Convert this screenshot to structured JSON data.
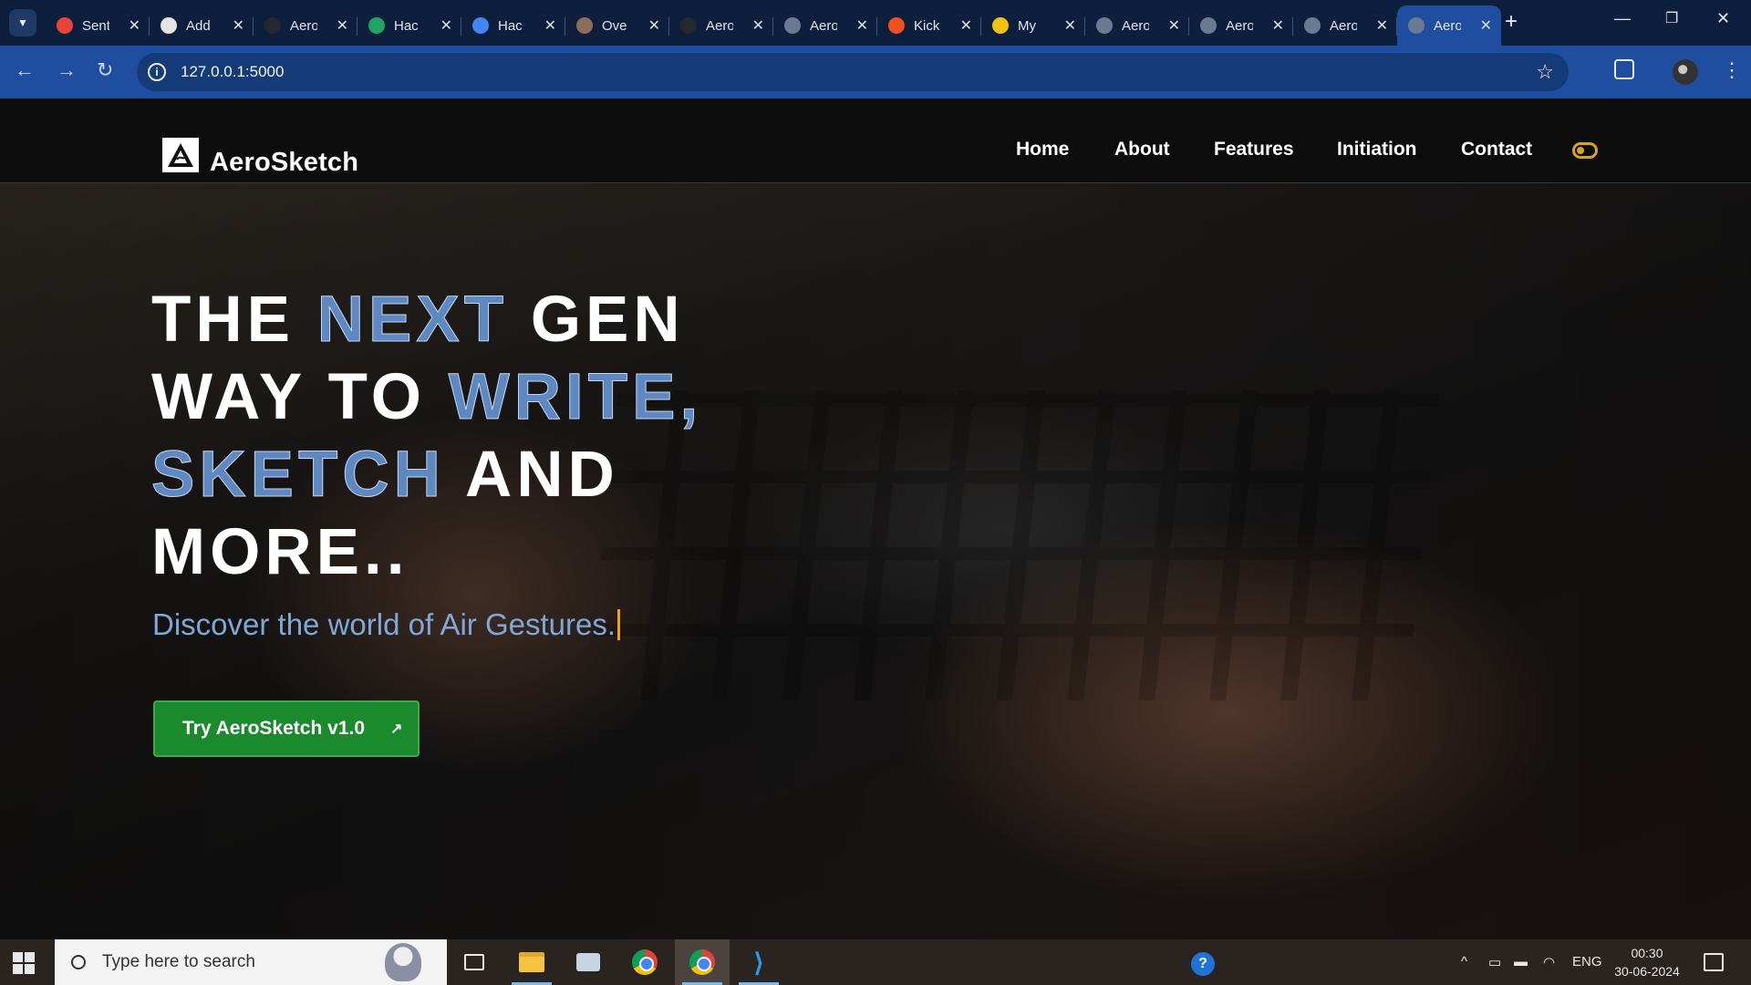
{
  "browser": {
    "tabs": [
      {
        "title": "Sent",
        "icon": "gmail-icon",
        "color": "#ea4335"
      },
      {
        "title": "Add",
        "icon": "openai-icon",
        "color": "#e5e5e5"
      },
      {
        "title": "Aero",
        "icon": "github-icon",
        "color": "#24292f"
      },
      {
        "title": "Hac",
        "icon": "google-drive-icon",
        "color": "#1fa463"
      },
      {
        "title": "Hac",
        "icon": "google-docs-icon",
        "color": "#4285f4"
      },
      {
        "title": "Ove",
        "icon": "avatar-icon",
        "color": "#8a6d5a"
      },
      {
        "title": "Aero",
        "icon": "github-icon",
        "color": "#24292f"
      },
      {
        "title": "Aero",
        "icon": "globe-icon",
        "color": "#6b7a93"
      },
      {
        "title": "Kick",
        "icon": "figma-icon",
        "color": "#f24e1e"
      },
      {
        "title": "My",
        "icon": "notes-icon",
        "color": "#f4c20d"
      },
      {
        "title": "Aero",
        "icon": "globe-icon",
        "color": "#6b7a93"
      },
      {
        "title": "Aero",
        "icon": "globe-icon",
        "color": "#6b7a93"
      },
      {
        "title": "Aero",
        "icon": "globe-icon",
        "color": "#6b7a93"
      },
      {
        "title": "Aero",
        "icon": "globe-icon",
        "color": "#6b7a93",
        "active": true
      }
    ],
    "url": "127.0.0.1:5000"
  },
  "site": {
    "brand": "AeroSketch",
    "nav": [
      "Home",
      "About",
      "Features",
      "Initiation",
      "Contact"
    ],
    "hero": {
      "line1_a": "THE ",
      "line1_b": "NEXT",
      "line1_c": " GEN",
      "line2_a": "WAY TO ",
      "line2_b": "WRITE,",
      "line3_a": "SKETCH",
      "line3_b": " AND",
      "line4": "MORE..",
      "subtitle": "Discover the world of Air Gestures.",
      "cta": "Try AeroSketch v1.0",
      "cta_arrow": "↗"
    },
    "colors": {
      "accent": "#5d88c2",
      "cta": "#1a8a2c",
      "toggle": "#d9a520"
    }
  },
  "taskbar": {
    "search_placeholder": "Type here to search",
    "language": "ENG",
    "time": "00:30",
    "date": "30-06-2024"
  }
}
